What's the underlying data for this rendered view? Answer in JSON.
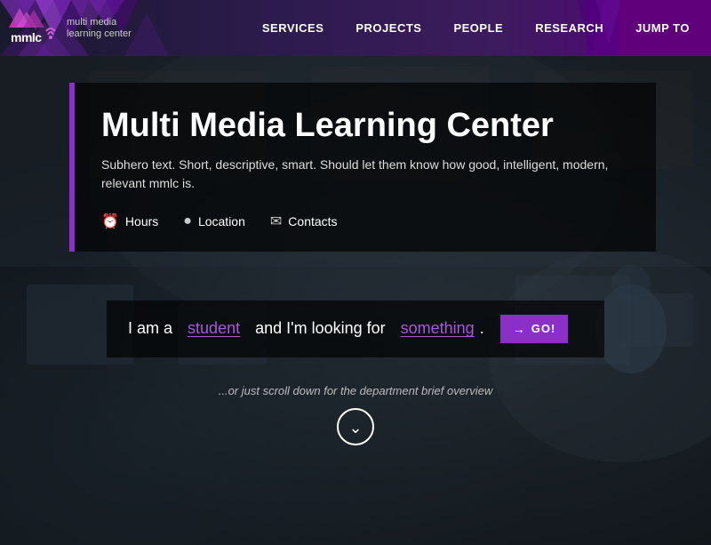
{
  "nav": {
    "logo": {
      "abbr": "mmlc",
      "line1": "multi media",
      "line2": "learning center"
    },
    "links": [
      {
        "label": "SERVICES",
        "id": "services"
      },
      {
        "label": "PROJECTS",
        "id": "projects"
      },
      {
        "label": "PEOPLE",
        "id": "people"
      },
      {
        "label": "RESEARCH",
        "id": "research"
      },
      {
        "label": "JUMP TO",
        "id": "jump-to",
        "special": true
      }
    ]
  },
  "hero": {
    "title": "Multi Media Learning Center",
    "subtitle": "Subhero text. Short, descriptive, smart. Should let them know how good, intelligent, modern, relevant mmlc is.",
    "info_links": [
      {
        "label": "Hours",
        "icon": "🕐",
        "id": "hours"
      },
      {
        "label": "Location",
        "icon": "📍",
        "id": "location"
      },
      {
        "label": "Contacts",
        "icon": "✉",
        "id": "contacts"
      }
    ]
  },
  "search": {
    "prefix": "I am a",
    "link1": "student",
    "middle": "and I'm looking for",
    "link2": "something",
    "suffix": ".",
    "go_label": "GO!"
  },
  "scroll": {
    "text": "...or just scroll down for the department brief overview"
  }
}
